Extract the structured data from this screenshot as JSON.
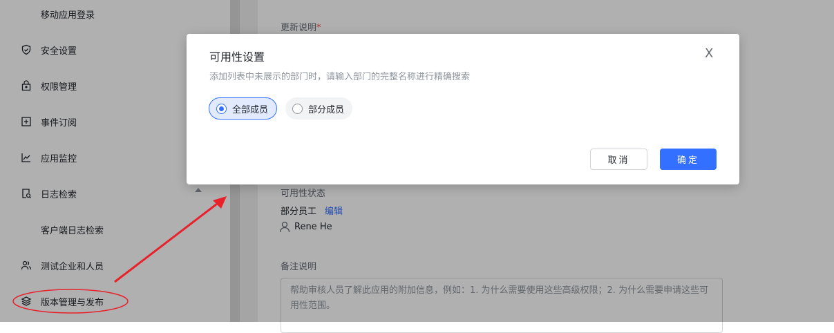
{
  "sidebar": {
    "items": [
      {
        "label": "移动应用登录",
        "icon": "none"
      },
      {
        "label": "安全设置",
        "icon": "shield-icon"
      },
      {
        "label": "权限管理",
        "icon": "lock-icon"
      },
      {
        "label": "事件订阅",
        "icon": "plus-square-icon"
      },
      {
        "label": "应用监控",
        "icon": "chart-line-icon"
      },
      {
        "label": "日志检索",
        "icon": "log-search-icon"
      },
      {
        "label": "客户端日志检索",
        "icon": "none"
      },
      {
        "label": "测试企业和人员",
        "icon": "users-icon"
      },
      {
        "label": "版本管理与发布",
        "icon": "layers-icon"
      }
    ]
  },
  "main": {
    "update_label": "更新说明",
    "required_mark": "*",
    "availability_label": "可用性状态",
    "availability_value": "部分员工",
    "edit_link": "编辑",
    "user_name": "Rene He",
    "notes_label": "备注说明",
    "notes_placeholder": "帮助审核人员了解此应用的附加信息，例如：1. 为什么需要使用这些高级权限；2. 为什么需要申请这些可用性范围。"
  },
  "modal": {
    "title": "可用性设置",
    "subtitle": "添加列表中未展示的部门时，请输入部门的完整名称进行精确搜索",
    "close": "X",
    "options": [
      "全部成员",
      "部分成员"
    ],
    "selected": "全部成员",
    "cancel": "取消",
    "confirm": "确定"
  },
  "colors": {
    "accent": "#3370ff",
    "annotation": "#e8212a"
  }
}
